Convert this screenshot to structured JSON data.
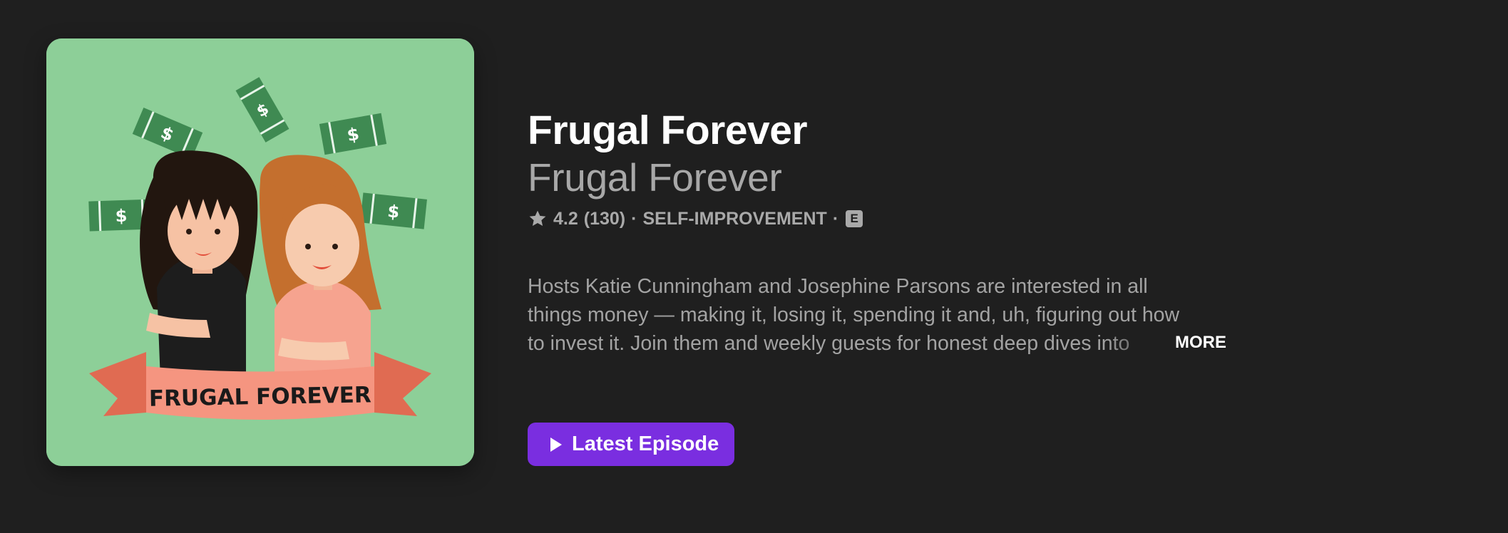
{
  "podcast": {
    "title": "Frugal Forever",
    "author": "Frugal Forever",
    "rating": "4.2",
    "rating_count": "(130)",
    "category": "SELF-IMPROVEMENT",
    "explicit_badge": "E",
    "separator": "·",
    "description": "Hosts Katie Cunningham and Josephine Parsons are interested in all things money — making it, losing it, spending it and, uh, figuring out how to invest it. Join them and weekly guests for honest deep dives into personal finance.",
    "more_label": "MORE",
    "artwork_banner_text": "FRUGAL FOREVER"
  },
  "actions": {
    "latest_episode_label": "Latest Episode"
  },
  "icons": {
    "rating": "star-icon",
    "play": "play-icon",
    "explicit": "explicit-badge"
  },
  "colors": {
    "background": "#1f1f1f",
    "accent": "#7a2ee0",
    "artwork_bg": "#8dcf98"
  }
}
